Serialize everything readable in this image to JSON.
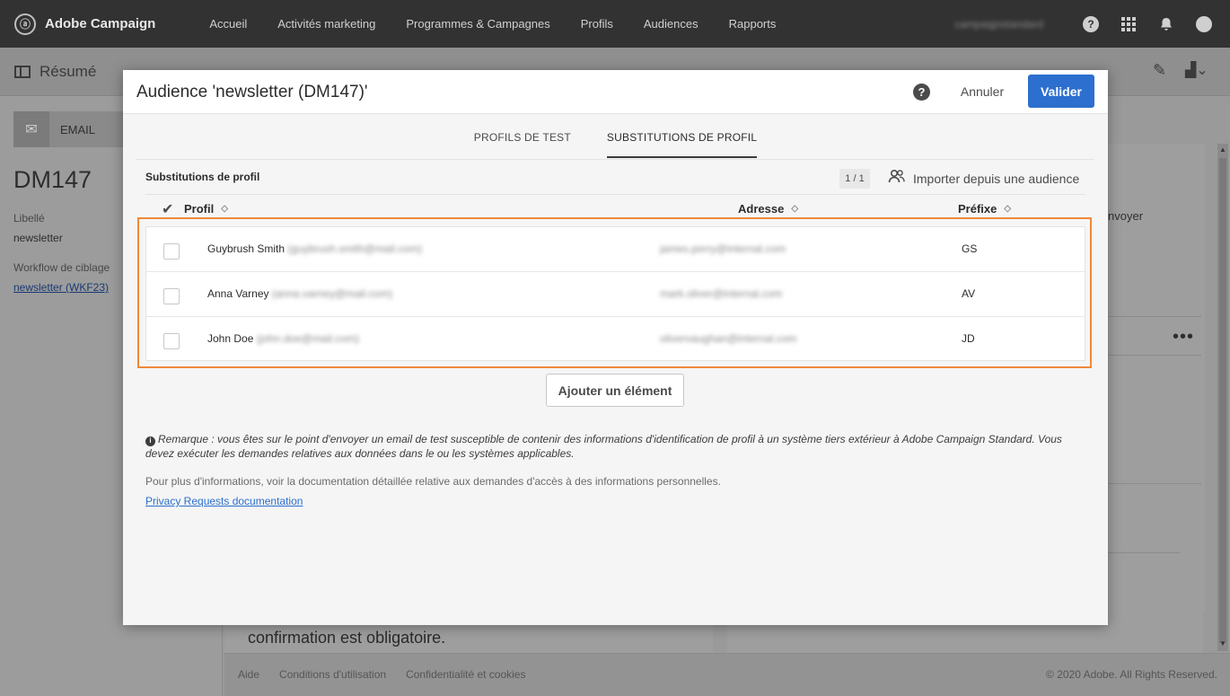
{
  "topnav": {
    "brand": "Adobe Campaign",
    "items": [
      "Accueil",
      "Activités marketing",
      "Programmes & Campagnes",
      "Profils",
      "Audiences",
      "Rapports"
    ],
    "user": "campaignstandard"
  },
  "background": {
    "summary_label": "Résumé",
    "email_tab": "EMAIL",
    "delivery_title": "DM147",
    "label_caption": "Libellé",
    "label_value": "newsletter",
    "workflow_caption": "Workflow de ciblage",
    "workflow_link": "newsletter (WKF23)",
    "right_text": "nvoyer",
    "content_text": "confirmation est obligatoire.",
    "footer_links": [
      "Aide",
      "Conditions d'utilisation",
      "Confidentialité et cookies"
    ],
    "footer_copy": "© 2020 Adobe. All Rights Reserved."
  },
  "modal": {
    "title": "Audience 'newsletter (DM147)'",
    "cancel_label": "Annuler",
    "validate_label": "Valider",
    "tabs": [
      "PROFILS DE TEST",
      "SUBSTITUTIONS DE PROFIL"
    ],
    "active_tab": "SUBSTITUTIONS DE PROFIL",
    "section_title": "Substitutions de profil",
    "pager": "1 / 1",
    "import_label": "Importer depuis une audience",
    "columns": {
      "profile": "Profil",
      "address": "Adresse",
      "prefix": "Préfixe"
    },
    "rows": [
      {
        "name": "Guybrush Smith",
        "email": "(guybrush.smith@mail.com)",
        "address": "james.perry@internal.com",
        "prefix": "GS"
      },
      {
        "name": "Anna Varney",
        "email": "(anna.varney@mail.com)",
        "address": "mark.oliver@internal.com",
        "prefix": "AV"
      },
      {
        "name": "John Doe",
        "email": "(john.doe@mail.com)",
        "address": "olivervaughan@internal.com",
        "prefix": "JD"
      }
    ],
    "add_label": "Ajouter un élément",
    "note": "Remarque : vous êtes sur le point d'envoyer un email de test susceptible de contenir des informations d'identification de profil à un système tiers extérieur à Adobe Campaign Standard. Vous devez exécuter les demandes relatives aux données dans le ou les systèmes applicables.",
    "more_info": "Pour plus d'informations, voir la documentation détaillée relative aux demandes d'accès à des informations personnelles.",
    "doc_link": "Privacy Requests documentation"
  },
  "colors": {
    "accent": "#2d6fce",
    "highlight": "#f0883a",
    "nav_bg": "#323232"
  },
  "icons": {
    "help": "help-circle-icon",
    "import": "users-import-icon",
    "check_all": "checkmark-icon",
    "sort": "sort-icon",
    "info": "info-circle-icon"
  }
}
